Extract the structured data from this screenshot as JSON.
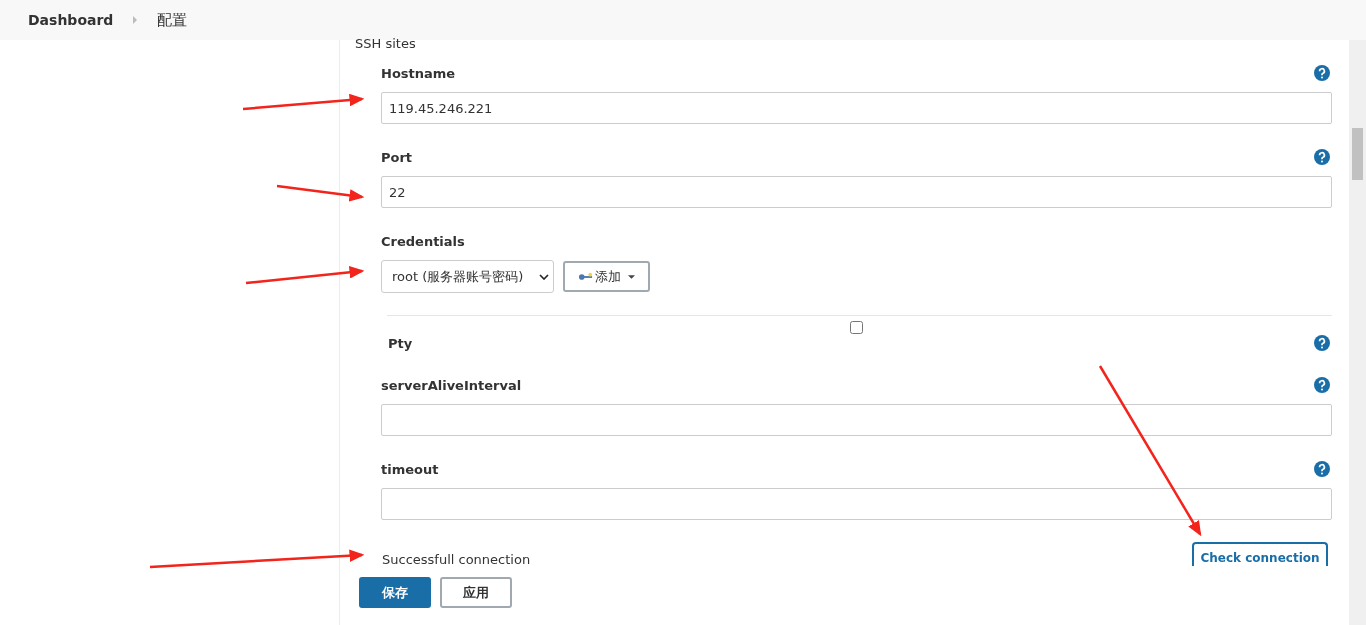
{
  "breadcrumb": [
    {
      "label": "Dashboard"
    },
    {
      "label": "配置"
    }
  ],
  "section": {
    "title": "SSH sites"
  },
  "fields": [
    {
      "kind": "text",
      "label": "Hostname",
      "value": "119.45.246.221",
      "help": true
    },
    {
      "kind": "text",
      "label": "Port",
      "value": "22",
      "help": true
    },
    {
      "kind": "credentials",
      "label": "Credentials",
      "value": "root (服务器账号密码)",
      "add_button": "添加",
      "help": false
    },
    {
      "kind": "checkbox",
      "label": "Pty",
      "checked": false,
      "help": true
    },
    {
      "kind": "text",
      "label": "serverAliveInterval",
      "help": true
    },
    {
      "kind": "text",
      "label": "timeout",
      "help": true
    }
  ],
  "status": {
    "message": "Successfull connection",
    "button": "Check connection"
  },
  "buttons": [
    {
      "label": "保存",
      "primary": true
    },
    {
      "label": "应用",
      "primary": false
    }
  ]
}
